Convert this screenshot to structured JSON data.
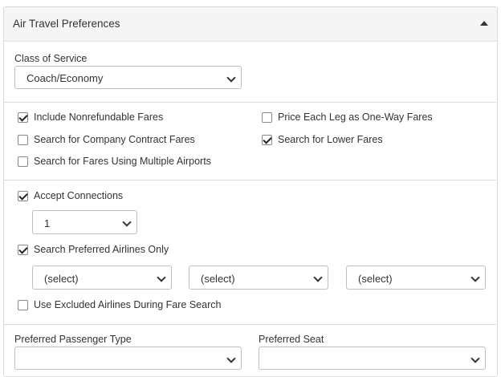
{
  "panel": {
    "title": "Air Travel Preferences",
    "collapse_icon": "caret-up-icon"
  },
  "class_of_service": {
    "label": "Class of Service",
    "value": "Coach/Economy"
  },
  "fare_options": {
    "include_nonrefundable": {
      "label": "Include Nonrefundable Fares",
      "checked": true
    },
    "price_each_leg": {
      "label": "Price Each Leg as One-Way Fares",
      "checked": false
    },
    "company_contract": {
      "label": "Search for Company Contract Fares",
      "checked": false
    },
    "lower_fares": {
      "label": "Search for Lower Fares",
      "checked": true
    },
    "multiple_airports": {
      "label": "Search for Fares Using Multiple Airports",
      "checked": false
    }
  },
  "connections": {
    "accept_label": "Accept Connections",
    "accept_checked": true,
    "count_value": "1"
  },
  "airlines": {
    "preferred_only_label": "Search Preferred Airlines Only",
    "preferred_only_checked": true,
    "selects": [
      "(select)",
      "(select)",
      "(select)"
    ],
    "use_excluded_label": "Use Excluded Airlines During Fare Search",
    "use_excluded_checked": false
  },
  "passenger": {
    "type_label": "Preferred Passenger Type",
    "seat_label": "Preferred Seat"
  },
  "colors": {
    "header_bg": "#f5f5f5",
    "border": "#d9d9d9"
  }
}
